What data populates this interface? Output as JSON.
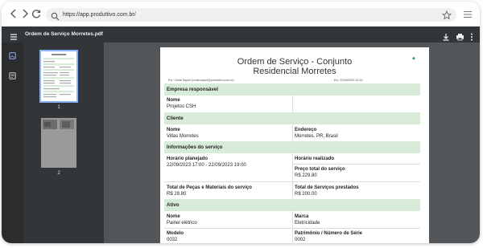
{
  "browser": {
    "url": "https://app.produttivo.com.br/"
  },
  "viewer": {
    "title": "Ordem de Serviço Morretes.pdf",
    "pages": [
      "1",
      "2"
    ]
  },
  "document": {
    "title_line1": "Ordem de Serviço - Conjunto",
    "title_line2": "Residencial Morretes",
    "author": "Por: Cintia Sayuri (cintia.sayuri@produttivo.com.br)",
    "date": "Em: 22/09/2023 15:16",
    "sections": {
      "empresa": "Empresa responsável",
      "cliente": "Cliente",
      "servico": "Informações do serviço",
      "ativo": "Ativo"
    },
    "fields": {
      "empresa_nome_label": "Nome",
      "empresa_nome_value": "Projetos CSH",
      "cliente_nome_label": "Nome",
      "cliente_nome_value": "Villas Morretes",
      "endereco_label": "Endereço",
      "endereco_value": "Morretes, PR, Brasil",
      "horario_planejado_label": "Horário planejado",
      "horario_planejado_value": "22/09/2023 17:00 - 22/09/2023 19:00",
      "horario_realizado_label": "Horário realizado",
      "preco_total_label": "Preço total do serviço",
      "preco_total_value": "R$ 229.80",
      "total_pecas_label": "Total de Peças e Materiais do serviço",
      "total_pecas_value": "R$ 29.80",
      "total_servicos_label": "Total de Serviços prestados",
      "total_servicos_value": "R$ 200.00",
      "ativo_nome_label": "Nome",
      "ativo_nome_value": "Painel elétrico",
      "marca_label": "Marca",
      "marca_value": "Eletricidade",
      "modelo_label": "Modelo",
      "modelo_value": "0032",
      "patrimonio_label": "Patrimônio / Número de Série",
      "patrimonio_value": "0002"
    }
  },
  "colors": {
    "section_bg": "#d8ebd8",
    "viewer_bar": "#323639",
    "viewer_bg": "#525659"
  }
}
